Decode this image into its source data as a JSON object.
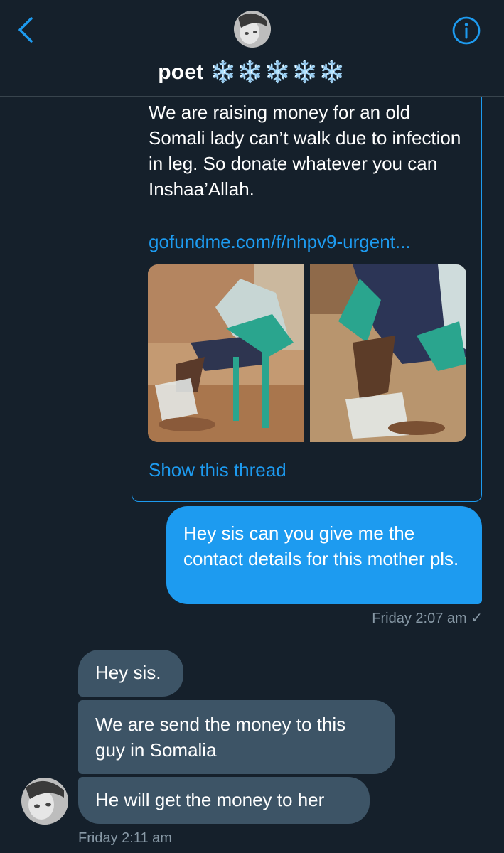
{
  "header": {
    "name": "poet",
    "name_decoration": "❄️❄️❄️❄️❄️",
    "back_icon": "chevron-left-icon",
    "info_icon": "info-icon"
  },
  "quoted_tweet": {
    "text": "We are raising money for an old Somali lady can’t walk due to infection in leg. So donate whatever you can Inshaa’Allah.",
    "link": "gofundme.com/f/nhpv9-urgent...",
    "show_thread": "Show this thread"
  },
  "messages": {
    "sent": {
      "text": "Hey sis can you give me the contact details for this mother pls.",
      "meta": "Friday 2:07 am ✓"
    },
    "received": [
      {
        "text": "Hey sis."
      },
      {
        "text": "We are send the money to this guy in Somalia"
      },
      {
        "text": "He will get the money to her"
      }
    ],
    "received_meta": "Friday 2:11 am"
  },
  "colors": {
    "background": "#15202b",
    "accent": "#1d9bf0",
    "received_bubble": "#3d5466",
    "meta_text": "#8899a6"
  }
}
